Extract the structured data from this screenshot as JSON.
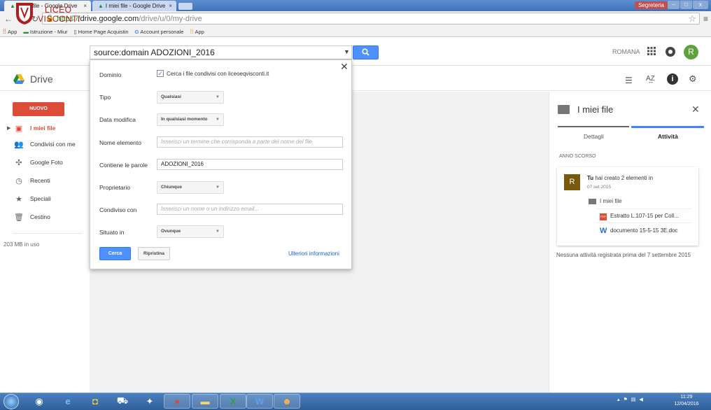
{
  "browser": {
    "tabs": [
      {
        "title": "I miei file - Google Drive",
        "close": "×"
      },
      {
        "title": "I miei file - Google Drive",
        "close": "×"
      }
    ],
    "window_user": "Segreteria",
    "url": {
      "https": "https://",
      "host": "drive.google.com",
      "path": "/drive/u/0/my-drive"
    },
    "bookmarks": [
      "App",
      "Istruzione - Miur",
      "Home Page Acquistin",
      "Account personale",
      "App"
    ]
  },
  "header": {
    "logo_line1": "LICEO",
    "logo_line2": "VISCONTI",
    "search_value": "source:domain ADOZIONI_2016",
    "user_name": "ROMANA",
    "avatar_letter": "R",
    "app_label": "Drive"
  },
  "sidebar": {
    "new_button": "NUOVO",
    "items": [
      {
        "label": "I miei file",
        "icon": "my-drive-icon",
        "active": true
      },
      {
        "label": "Condivisi con me",
        "icon": "shared-icon"
      },
      {
        "label": "Google Foto",
        "icon": "photos-icon"
      },
      {
        "label": "Recenti",
        "icon": "clock-icon"
      },
      {
        "label": "Speciali",
        "icon": "star-icon"
      },
      {
        "label": "Cestino",
        "icon": "trash-icon"
      }
    ],
    "storage": "203 MB in uso"
  },
  "search_panel": {
    "fields": {
      "dominio_label": "Dominio",
      "dominio_check": "Cerca i file condivisi con liceoeqvisconti.it",
      "tipo_label": "Tipo",
      "tipo_value": "Qualsiasi",
      "data_label": "Data modifica",
      "data_value": "In qualsiasi momento",
      "nome_label": "Nome elemento",
      "nome_placeholder": "Inserisci un termine che corrisponda a parte del nome del file",
      "parole_label": "Contiene le parole",
      "parole_value": "ADOZIONI_2016",
      "proprietario_label": "Proprietario",
      "proprietario_value": "Chiunque",
      "condiviso_label": "Condiviso con",
      "condiviso_placeholder": "Inserisci un nome o un indirizzo email...",
      "situato_label": "Situato in",
      "situato_value": "Ovunque"
    },
    "search_button": "Cerca",
    "reset_button": "Ripristina",
    "more_info": "Ulteriori informazioni"
  },
  "details": {
    "title": "I miei file",
    "tab_details": "Dettagli",
    "tab_activity": "Attività",
    "section": "ANNO SCORSO",
    "activity": {
      "avatar": "R",
      "actor": "Tu",
      "text": " hai creato 2 elementi in",
      "date": "07 set 2015",
      "folder": "I miei file",
      "file1": "Estratto L.107-15 per Coll...",
      "file2": "documento 15-5-15 3E.doc"
    },
    "no_activity": "Nessuna attività registrata prima del 7 settembre 2015"
  },
  "taskbar": {
    "time": "11:29",
    "date": "12/04/2016"
  }
}
